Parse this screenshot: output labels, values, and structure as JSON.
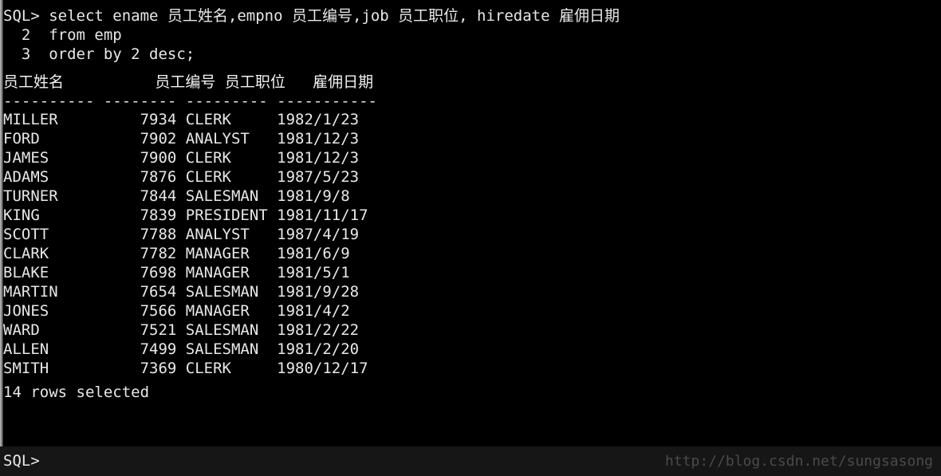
{
  "terminal": {
    "prompt_symbol": "SQL>",
    "background_color": "#000000",
    "foreground_color": "#e8e8e8",
    "prompt_bar_color": "#161616",
    "watermark_color": "#4a4a48"
  },
  "query": {
    "line1": "SQL> select ename 员工姓名,empno 员工编号,job 员工职位, hiredate 雇佣日期",
    "line2": "  2  from emp",
    "line3": "  3  order by 2 desc;"
  },
  "result": {
    "header_line": "员工姓名          员工编号 员工职位   雇佣日期",
    "separator_line": "---------- -------- --------- -----------",
    "columns": [
      "员工姓名",
      "员工编号",
      "员工职位",
      "雇佣日期"
    ],
    "rows": [
      {
        "ename": "MILLER",
        "empno": "7934",
        "job": "CLERK",
        "hiredate": "1982/1/23"
      },
      {
        "ename": "FORD",
        "empno": "7902",
        "job": "ANALYST",
        "hiredate": "1981/12/3"
      },
      {
        "ename": "JAMES",
        "empno": "7900",
        "job": "CLERK",
        "hiredate": "1981/12/3"
      },
      {
        "ename": "ADAMS",
        "empno": "7876",
        "job": "CLERK",
        "hiredate": "1987/5/23"
      },
      {
        "ename": "TURNER",
        "empno": "7844",
        "job": "SALESMAN",
        "hiredate": "1981/9/8"
      },
      {
        "ename": "KING",
        "empno": "7839",
        "job": "PRESIDENT",
        "hiredate": "1981/11/17"
      },
      {
        "ename": "SCOTT",
        "empno": "7788",
        "job": "ANALYST",
        "hiredate": "1987/4/19"
      },
      {
        "ename": "CLARK",
        "empno": "7782",
        "job": "MANAGER",
        "hiredate": "1981/6/9"
      },
      {
        "ename": "BLAKE",
        "empno": "7698",
        "job": "MANAGER",
        "hiredate": "1981/5/1"
      },
      {
        "ename": "MARTIN",
        "empno": "7654",
        "job": "SALESMAN",
        "hiredate": "1981/9/28"
      },
      {
        "ename": "JONES",
        "empno": "7566",
        "job": "MANAGER",
        "hiredate": "1981/4/2"
      },
      {
        "ename": "WARD",
        "empno": "7521",
        "job": "SALESMAN",
        "hiredate": "1981/2/22"
      },
      {
        "ename": "ALLEN",
        "empno": "7499",
        "job": "SALESMAN",
        "hiredate": "1981/2/20"
      },
      {
        "ename": "SMITH",
        "empno": "7369",
        "job": "CLERK",
        "hiredate": "1980/12/17"
      }
    ],
    "status": "14 rows selected"
  },
  "watermark": {
    "text": "http://blog.csdn.net/sungsasong"
  }
}
